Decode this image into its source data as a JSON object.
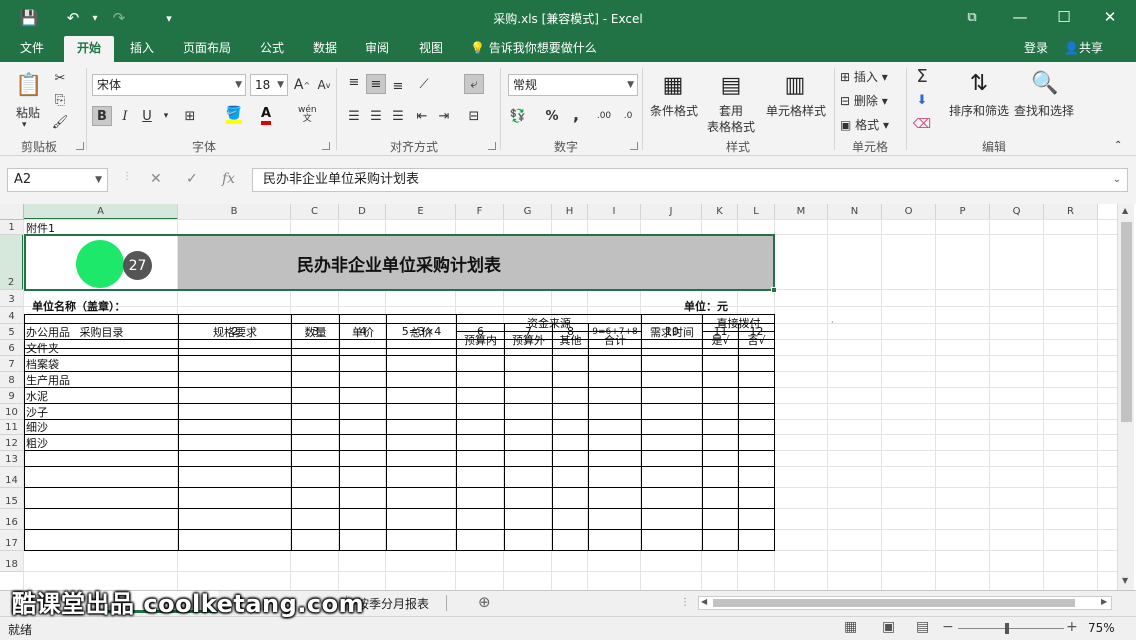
{
  "window": {
    "title": "采购.xls  [兼容模式] - Excel",
    "minimize": "—",
    "maximize": "☐",
    "close": "✕",
    "ribbon_options": "⧉"
  },
  "quick_access": {
    "save": "💾",
    "undo": "↶",
    "redo": "↷",
    "customize": "▾"
  },
  "tabs": [
    "文件",
    "开始",
    "插入",
    "页面布局",
    "公式",
    "数据",
    "审阅",
    "视图"
  ],
  "active_tab": "开始",
  "tell_me": "告诉我你想要做什么",
  "account": {
    "login": "登录",
    "share": "共享"
  },
  "ribbon": {
    "clipboard": {
      "label": "剪贴板",
      "paste": "粘贴"
    },
    "font": {
      "label": "字体",
      "name": "宋体",
      "size": "18",
      "bold": "B",
      "italic": "I",
      "underline": "U",
      "wen": "wén"
    },
    "alignment": {
      "label": "对齐方式"
    },
    "number": {
      "label": "数字",
      "format": "常规",
      "percent": "%",
      "comma": ","
    },
    "styles": {
      "label": "样式",
      "conditional": "条件格式",
      "table_format_1": "套用",
      "table_format_2": "表格格式",
      "cell_styles": "单元格样式"
    },
    "cells": {
      "label": "单元格",
      "insert": "插入",
      "delete": "删除",
      "format": "格式"
    },
    "editing": {
      "label": "编辑",
      "sort": "排序和筛选",
      "find": "查找和选择"
    }
  },
  "formula_bar": {
    "name_box": "A2",
    "fx": "fx",
    "value": "民办非企业单位采购计划表"
  },
  "columns": [
    "A",
    "B",
    "C",
    "D",
    "E",
    "F",
    "G",
    "H",
    "I",
    "J",
    "K",
    "L",
    "M",
    "N",
    "O",
    "P",
    "Q",
    "R"
  ],
  "rows": [
    "1",
    "2",
    "3",
    "4",
    "5",
    "6",
    "7",
    "8",
    "9",
    "10",
    "11",
    "12",
    "13",
    "14",
    "15",
    "16",
    "17",
    "18"
  ],
  "sheet": {
    "r1": "附件1",
    "title": "民办非企业单位采购计划表",
    "badge": "27",
    "r3_left": "单位名称（盖章）：",
    "r3_right": "单位：元",
    "headers": {
      "catalog": "采购目录",
      "spec": "规格要求",
      "qty": "数量",
      "price": "单价",
      "total": "总价",
      "funds": "资金来源",
      "in_budget": "预算内",
      "out_budget": "预算外",
      "other": "其他",
      "sum": "合计",
      "need_time": "需求时间",
      "direct": "直接拨付",
      "yes": "是√",
      "no": "否√"
    },
    "row6": [
      "办公用品",
      "2",
      "3",
      "4",
      "5=3×4",
      "6",
      "7",
      "8",
      "9=6+7+8",
      "10",
      "11",
      "12"
    ],
    "items": [
      "文件夹",
      "档案袋",
      "生产用品",
      "水泥",
      "沙子",
      "细沙",
      "粗沙"
    ]
  },
  "sheet_tabs": {
    "quarterly": "按季分月报表"
  },
  "status": {
    "ready": "就绪",
    "zoom": "75%"
  },
  "watermark": "酷课堂出品 coolketang.com",
  "colors": {
    "excel_green": "#217346",
    "selection": "#217346",
    "badge_green": "#1ee86a",
    "badge_grey": "#555555",
    "title_fill": "#c0c0c0"
  }
}
